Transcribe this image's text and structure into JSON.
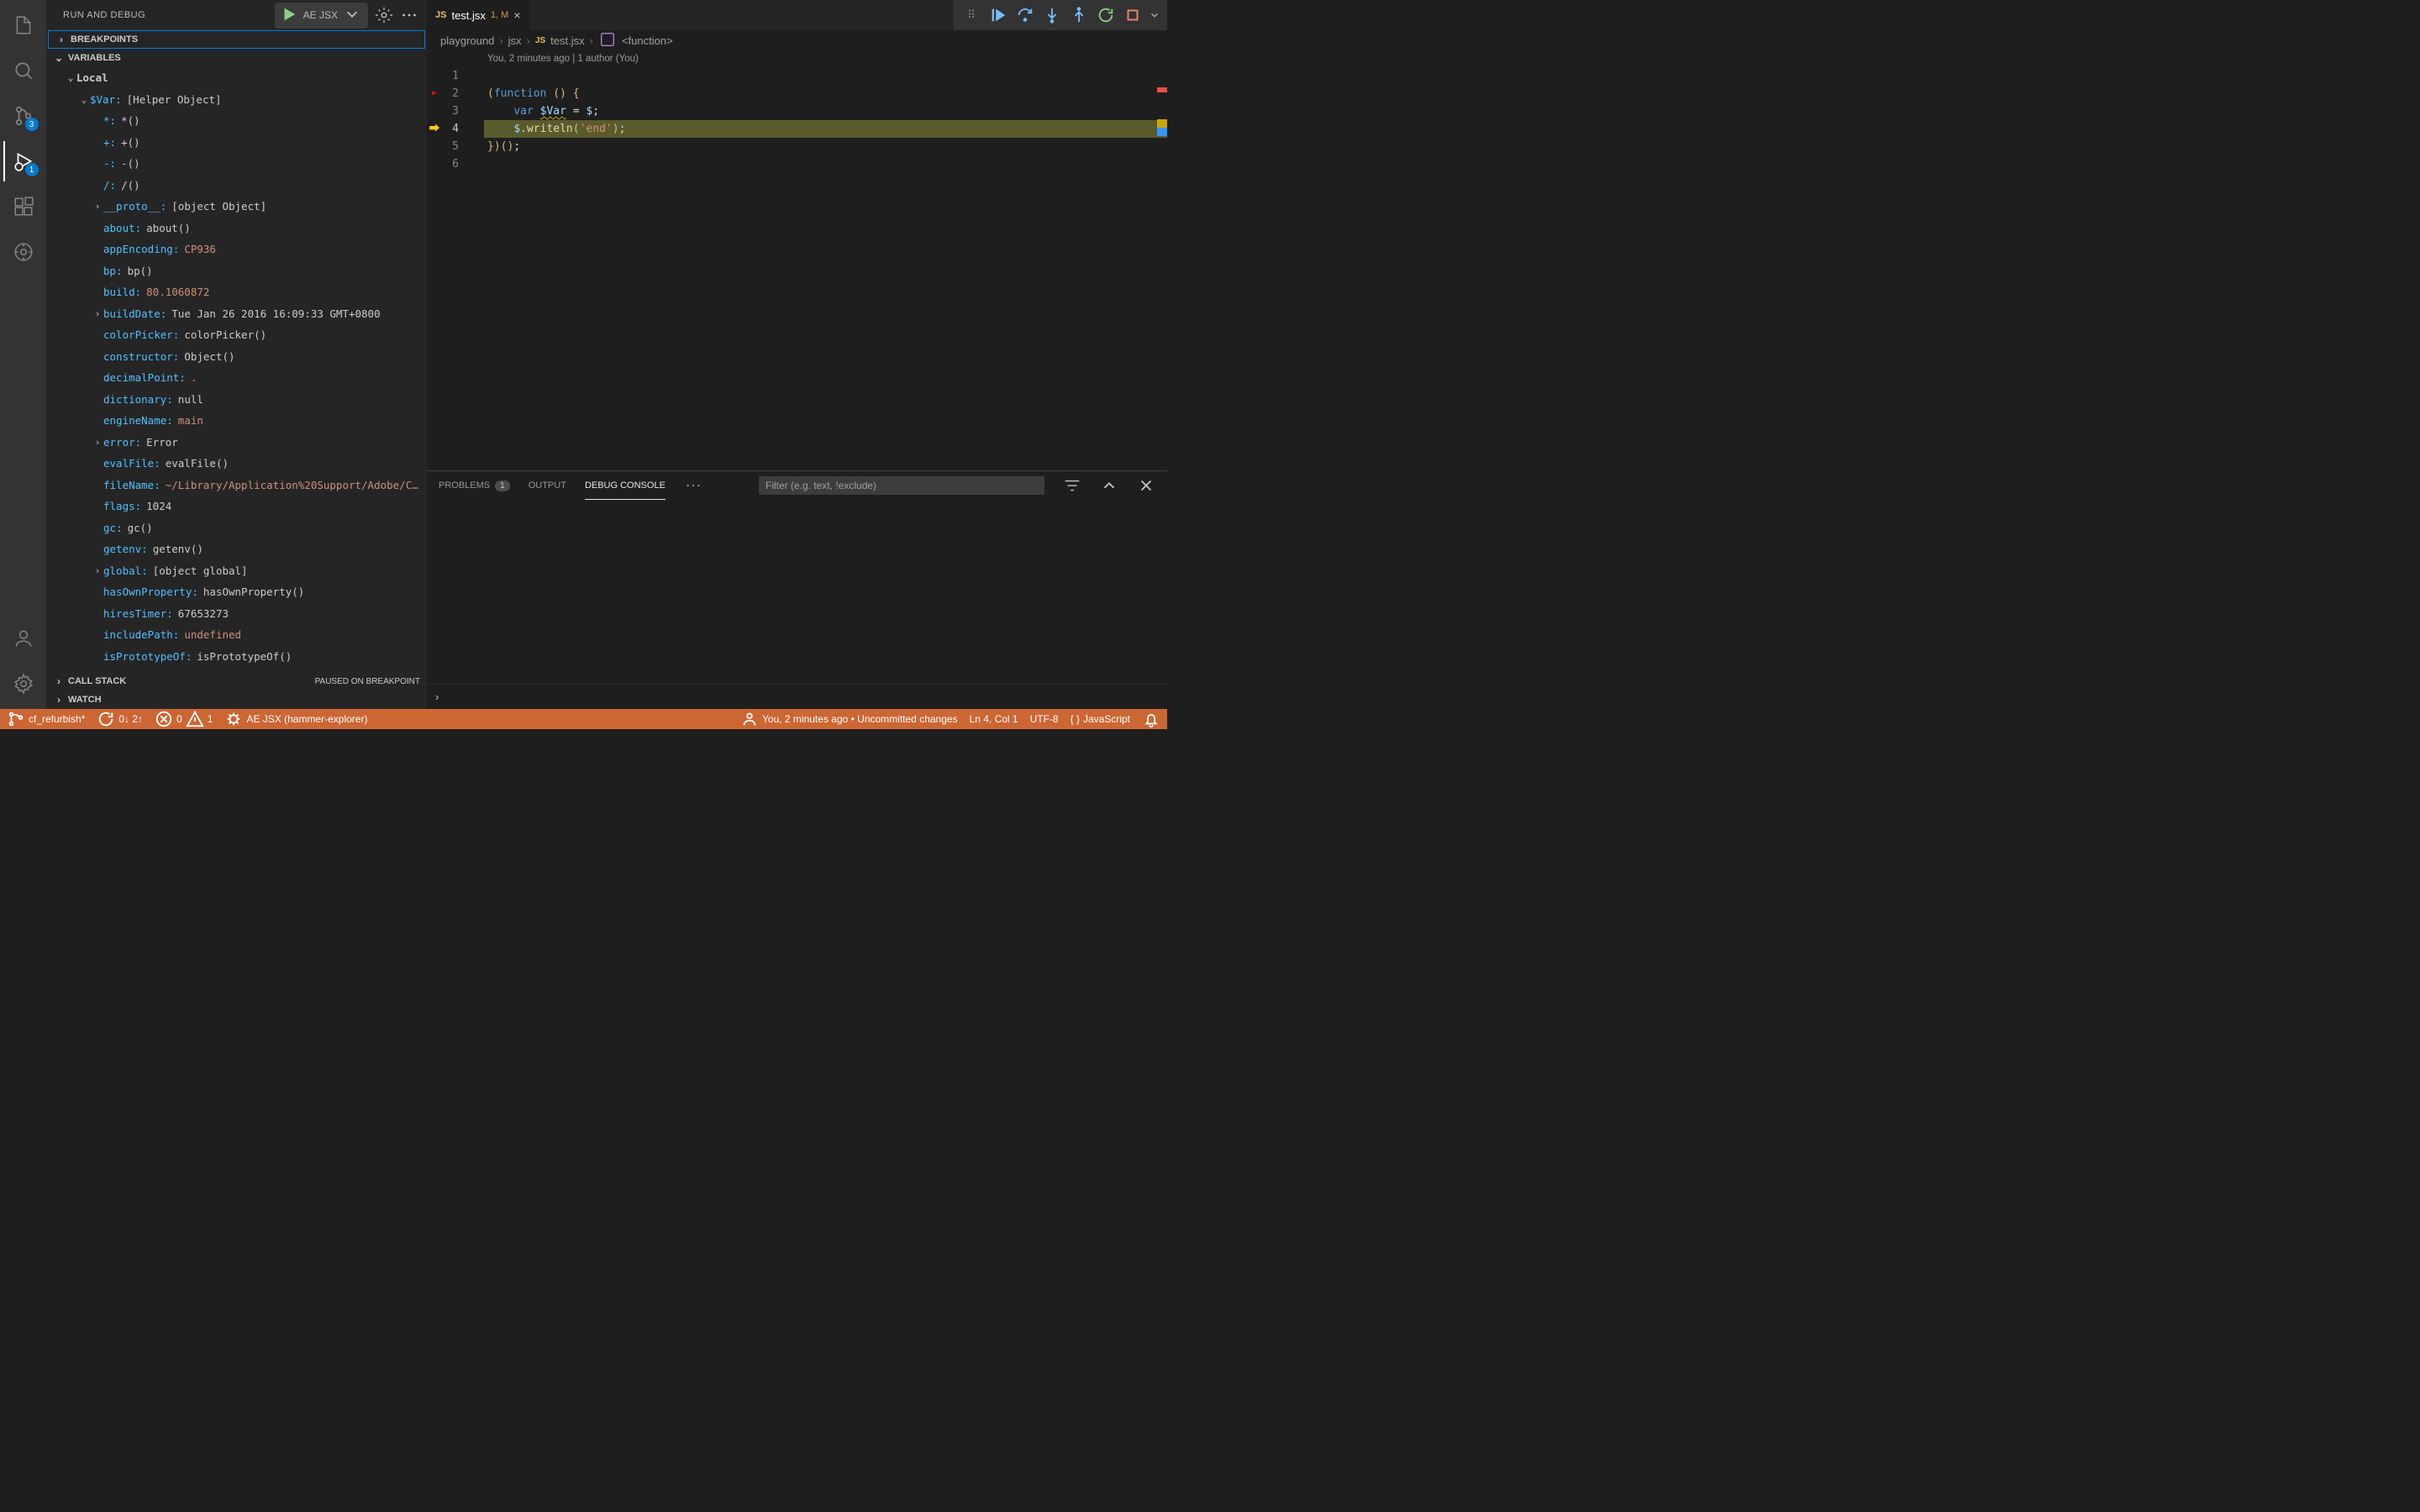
{
  "activity": {
    "badges": {
      "scm": "3",
      "debug": "1"
    }
  },
  "sidebar": {
    "title": "RUN AND DEBUG",
    "config": "AE JSX",
    "sections": {
      "breakpoints": "BREAKPOINTS",
      "variables": "VARIABLES",
      "callstack": "CALL STACK",
      "callstack_status": "PAUSED ON BREAKPOINT",
      "watch": "WATCH"
    },
    "scope": "Local",
    "varHeader": {
      "key": "$Var:",
      "val": "[Helper Object]"
    },
    "vars": [
      {
        "k": "*:",
        "v": "*()"
      },
      {
        "k": "+:",
        "v": "+()"
      },
      {
        "k": "-:",
        "v": "-()"
      },
      {
        "k": "/:",
        "v": "/()"
      },
      {
        "k": "__proto__:",
        "v": "[object Object]",
        "exp": true
      },
      {
        "k": "about:",
        "v": "about()"
      },
      {
        "k": "appEncoding:",
        "v": "CP936",
        "str": true
      },
      {
        "k": "bp:",
        "v": "bp()"
      },
      {
        "k": "build:",
        "v": "80.1060872",
        "str": true
      },
      {
        "k": "buildDate:",
        "v": "Tue Jan 26 2016 16:09:33 GMT+0800",
        "exp": true
      },
      {
        "k": "colorPicker:",
        "v": "colorPicker()"
      },
      {
        "k": "constructor:",
        "v": "Object()"
      },
      {
        "k": "decimalPoint:",
        "v": ".",
        "str": true
      },
      {
        "k": "dictionary:",
        "v": "null"
      },
      {
        "k": "engineName:",
        "v": "main",
        "str": true
      },
      {
        "k": "error:",
        "v": "Error",
        "exp": true
      },
      {
        "k": "evalFile:",
        "v": "evalFile()"
      },
      {
        "k": "fileName:",
        "v": "~/Library/Application%20Support/Adobe/C…",
        "str": true
      },
      {
        "k": "flags:",
        "v": "1024"
      },
      {
        "k": "gc:",
        "v": "gc()"
      },
      {
        "k": "getenv:",
        "v": "getenv()"
      },
      {
        "k": "global:",
        "v": "[object global]",
        "exp": true
      },
      {
        "k": "hasOwnProperty:",
        "v": "hasOwnProperty()"
      },
      {
        "k": "hiresTimer:",
        "v": "67653273"
      },
      {
        "k": "includePath:",
        "v": "undefined",
        "str": true
      },
      {
        "k": "isPrototypeOf:",
        "v": "isPrototypeOf()"
      }
    ]
  },
  "tabs": {
    "name": "test.jsx",
    "mod": "1, M"
  },
  "breadcrumb": {
    "p1": "playground",
    "p2": "jsx",
    "p3": "test.jsx",
    "p4": "<function>"
  },
  "codelens": "You, 2 minutes ago | 1 author (You)",
  "code": {
    "lines": [
      "1",
      "2",
      "3",
      "4",
      "5",
      "6"
    ]
  },
  "panel": {
    "problems": "PROBLEMS",
    "problems_count": "1",
    "output": "OUTPUT",
    "debug": "DEBUG CONSOLE",
    "filter_ph": "Filter (e.g. text, !exclude)"
  },
  "status": {
    "branch": "cf_refurbish*",
    "sync": "0↓ 2↑",
    "errors": "0",
    "warnings": "1",
    "debug_target": "AE JSX (hammer-explorer)",
    "blame": "You, 2 minutes ago • Uncommitted changes",
    "pos": "Ln 4, Col 1",
    "encoding": "UTF-8",
    "lang": "JavaScript"
  }
}
